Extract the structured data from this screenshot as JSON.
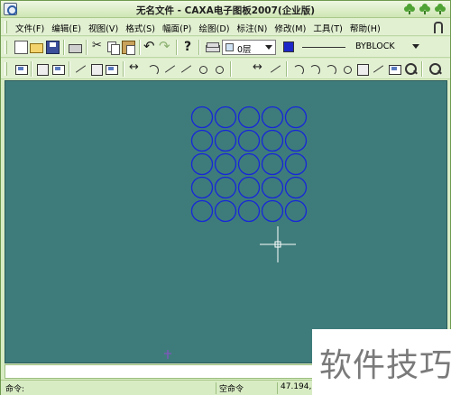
{
  "window": {
    "title": "无名文件 - CAXA电子图板2007(企业版)"
  },
  "menu": {
    "items": [
      "文件(F)",
      "编辑(E)",
      "视图(V)",
      "格式(S)",
      "幅面(P)",
      "绘图(D)",
      "标注(N)",
      "修改(M)",
      "工具(T)",
      "帮助(H)"
    ]
  },
  "toolbar_standard": {
    "icons": [
      "new-file-icon",
      "open-folder-icon",
      "save-icon",
      "print-icon",
      "cut-icon",
      "copy-icon",
      "paste-icon",
      "undo-icon",
      "redo-icon",
      "help-icon",
      "layer-manager-icon"
    ],
    "layer_value": "0层",
    "color_hex": "#1d28c8",
    "linetype_value": "BYBLOCK"
  },
  "toolbar_properties": {
    "icons": [
      "snap-icon",
      "ortho-icon",
      "grid-icon",
      "polyline-icon",
      "dimension-icon",
      "frame-icon",
      "rotate-icon",
      "curve-icon",
      "spline-icon",
      "arrow-icon",
      "group-icon",
      "node-icon",
      "distance-icon",
      "angle-icon",
      "block-icon",
      "point-icon",
      "hatch-icon",
      "align-icon",
      "measure-icon",
      "table-icon",
      "title-icon",
      "param-icon",
      "zoom-icon"
    ]
  },
  "drawing": {
    "background": "#3e7c7b",
    "circle_color": "#1727d8",
    "grid": {
      "rows": 5,
      "cols": 5
    },
    "crosshair_color": "#ffffff"
  },
  "command_line": {
    "value": ""
  },
  "status": {
    "prompt_label": "命令:",
    "current_command": "空命令",
    "coordinates": "47.194,58"
  },
  "watermark": {
    "text": "软件技巧"
  }
}
